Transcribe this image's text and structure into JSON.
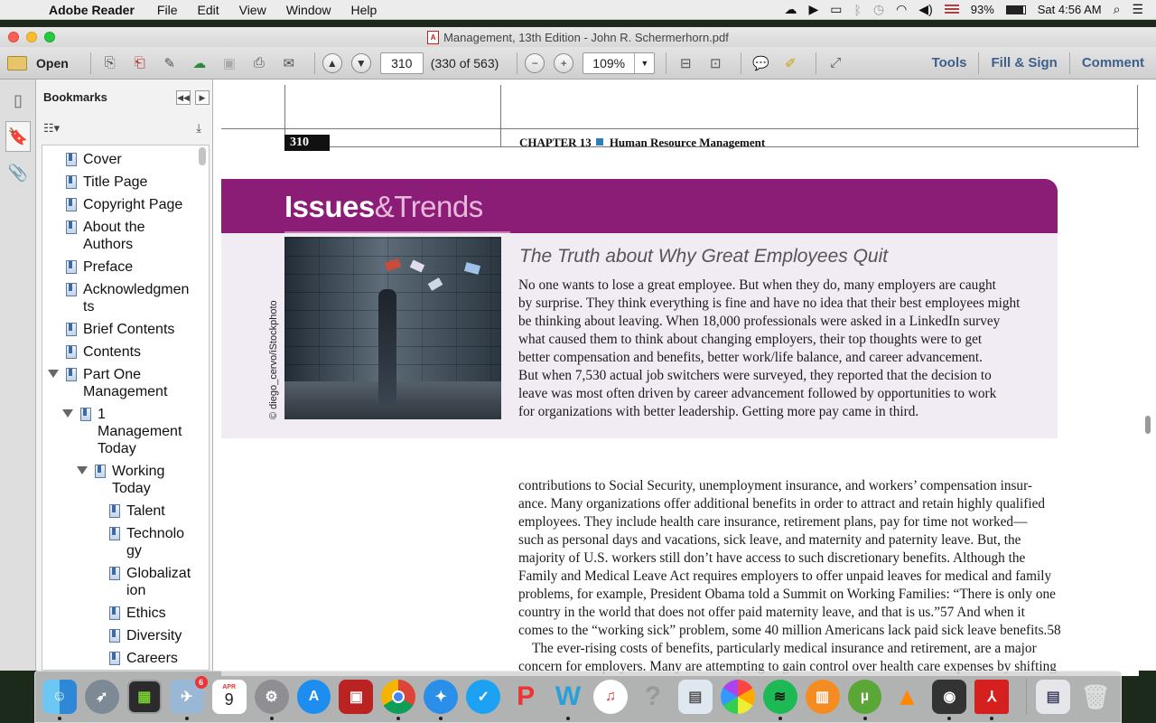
{
  "menubar": {
    "app": "Adobe Reader",
    "items": [
      "File",
      "Edit",
      "View",
      "Window",
      "Help"
    ],
    "battery": "93%",
    "clock": "Sat 4:56 AM"
  },
  "window": {
    "title": "Management, 13th Edition - John R. Schermerhorn.pdf"
  },
  "toolbar": {
    "open": "Open",
    "page_value": "310",
    "page_count": "(330 of 563)",
    "zoom": "109%",
    "tools": "Tools",
    "fill_sign": "Fill & Sign",
    "comment": "Comment"
  },
  "bookmarks": {
    "title": "Bookmarks",
    "items": [
      "Cover",
      "Title Page",
      "Copyright Page",
      "About the Authors",
      "Preface",
      "Acknowledgments",
      "Brief Contents",
      "Contents",
      "Part One Management",
      "1 Management Today",
      "Working Today",
      "Talent",
      "Technology",
      "Globalization",
      "Ethics",
      "Diversity",
      "Careers"
    ],
    "wrapped": {
      "about_l1": "About the",
      "about_l2": "Authors",
      "ack_l1": "Acknowledgmen",
      "ack_l2": "ts",
      "part_l1": "Part One",
      "part_l2": "Management",
      "mt_l1": "1",
      "mt_l2": "Management",
      "mt_l3": "Today",
      "wt_l1": "Working",
      "wt_l2": "Today",
      "tech_l1": "Technolo",
      "tech_l2": "gy",
      "glob_l1": "Globalizat",
      "glob_l2": "ion"
    }
  },
  "page": {
    "number": "310",
    "chapter": "CHAPTER 13",
    "chapter_title": "Human Resource Management",
    "banner_a": "Issues",
    "banner_b": "&Trends",
    "heading": "The Truth about Why Great Employees Quit",
    "photo_credit": "© diego_cervo/iStockphoto",
    "box_lines": [
      "No one wants to lose a great employee. But when they do, many employers are caught",
      "by surprise. They think everything is fine and have no idea that their best employees might",
      "be thinking about leaving. When 18,000 professionals were asked in a LinkedIn survey",
      "what caused them to think about changing employers, their top thoughts were to get",
      "better compensation and benefits, better work/life balance, and career advancement.",
      "But when 7,530 actual job switchers were surveyed, they reported that the decision to",
      "leave was most often driven by career advancement followed by opportunities to work",
      "for organizations with better leadership. Getting more pay came in third."
    ],
    "body_lines": [
      "contributions to Social Security, unemployment insurance, and workers’ compensation insur-",
      "ance. Many organizations offer additional benefits in order to attract and retain highly qualified",
      "employees. They include health care insurance, retirement plans, pay for time not worked—",
      "such as personal days and vacations, sick leave, and maternity and paternity leave. But, the",
      "majority of U.S. workers still don’t have access to such discretionary benefits. Although the",
      "Family and Medical Leave Act requires employers to offer unpaid leaves for medical and family",
      "problems, for example, President Obama told a Summit on Working Families: “There is only one",
      "country in the world that does not offer paid maternity leave, and that is us.”57 And when it",
      "comes to the “working sick” problem, some 40 million Americans lack paid sick leave benefits.58",
      "    The ever-rising costs of benefits, particularly medical insurance and retirement, are a major",
      "concern for employers. Many are attempting to gain control over health care expenses by shifting"
    ]
  },
  "dock": {
    "calendar_month": "APR",
    "calendar_day": "9",
    "mail_badge": "6",
    "apps": [
      "Finder",
      "Launchpad",
      "Activity Monitor",
      "Mail",
      "Calendar",
      "System Preferences",
      "App Store",
      "Photo Booth",
      "Chrome",
      "Safari",
      "Twitter",
      "WPS",
      "Word",
      "iTunes",
      "Help",
      "Preview",
      "Photos",
      "Spotify",
      "iBooks",
      "uTorrent",
      "VLC",
      "Video",
      "Acrobat",
      "Files",
      "Trash"
    ]
  }
}
